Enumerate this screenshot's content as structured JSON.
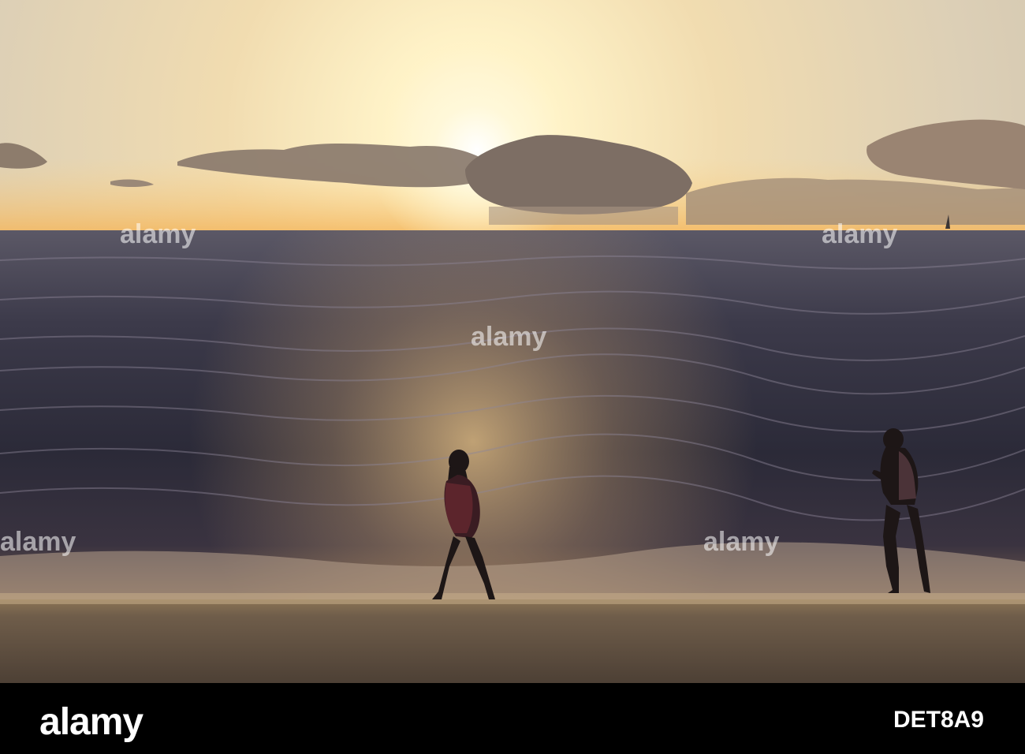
{
  "watermark": {
    "brand": "alamy"
  },
  "footer": {
    "logo": "alamy",
    "image_id": "DET8A9"
  },
  "colors": {
    "sky_top": "#f4e2b8",
    "sun": "#fffbe8",
    "horizon": "#f5c46a",
    "sea_dark": "#2c2a3a",
    "sea_glint": "#d9b070",
    "sand": "#6e5d4c",
    "silhouette": "#1c1616"
  }
}
